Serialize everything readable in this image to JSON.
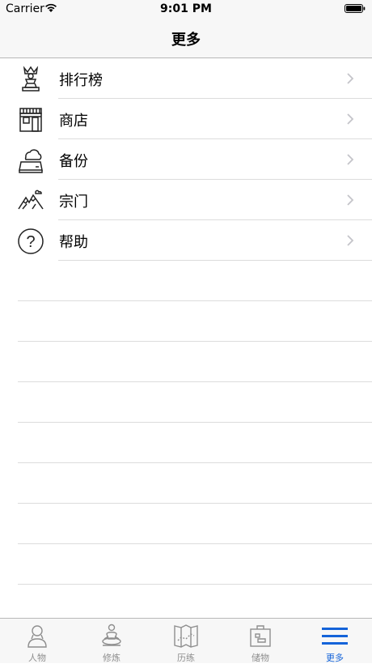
{
  "status_bar": {
    "carrier": "Carrier",
    "time": "9:01 PM"
  },
  "nav": {
    "title": "更多"
  },
  "menu": [
    {
      "label": "排行榜",
      "icon": "chess-rank-icon"
    },
    {
      "label": "商店",
      "icon": "store-icon"
    },
    {
      "label": "备份",
      "icon": "cloud-backup-icon"
    },
    {
      "label": "宗门",
      "icon": "mountain-sect-icon"
    },
    {
      "label": "帮助",
      "icon": "help-question-icon"
    }
  ],
  "tabs": [
    {
      "label": "人物",
      "icon": "person-icon",
      "active": false
    },
    {
      "label": "修炼",
      "icon": "meditation-icon",
      "active": false
    },
    {
      "label": "历练",
      "icon": "map-icon",
      "active": false
    },
    {
      "label": "储物",
      "icon": "storage-bag-icon",
      "active": false
    },
    {
      "label": "更多",
      "icon": "hamburger-menu-icon",
      "active": true
    }
  ],
  "colors": {
    "accent": "#1463d9",
    "separator": "#dcdcdc",
    "bar_bg": "#f7f7f7"
  }
}
